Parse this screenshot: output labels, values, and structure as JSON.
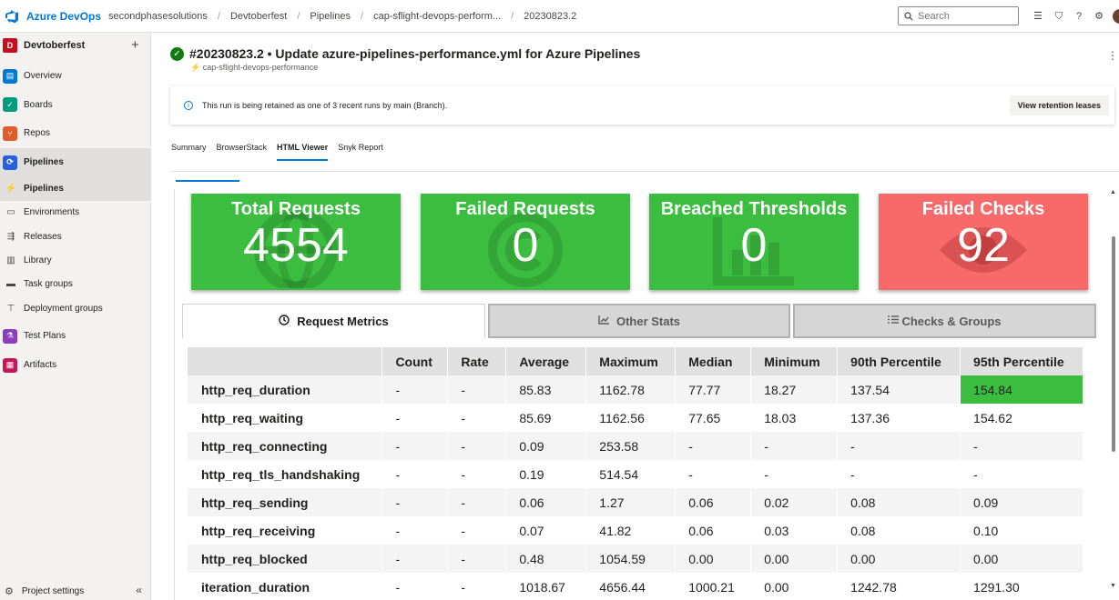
{
  "topbar": {
    "brand": "Azure DevOps",
    "breadcrumbs": [
      "secondphasesolutions",
      "Devtoberfest",
      "Pipelines",
      "cap-sflight-devops-perform...",
      "20230823.2"
    ],
    "search_placeholder": "Search",
    "icons": [
      "list-icon",
      "marketplace-icon",
      "help-icon",
      "user-settings-icon"
    ]
  },
  "sidebar": {
    "project_initial": "D",
    "project_name": "Devtoberfest",
    "items": [
      {
        "label": "Overview",
        "icon": "overview-icon",
        "color": "#0078d4"
      },
      {
        "label": "Boards",
        "icon": "boards-icon",
        "color": "#009c7b"
      },
      {
        "label": "Repos",
        "icon": "repos-icon",
        "color": "#e05c2c"
      },
      {
        "label": "Pipelines",
        "icon": "pipelines-icon",
        "color": "#2560e0"
      }
    ],
    "subitems": [
      {
        "label": "Pipelines",
        "icon": "pipelines-sub-icon"
      },
      {
        "label": "Environments",
        "icon": "environments-icon"
      },
      {
        "label": "Releases",
        "icon": "releases-icon"
      },
      {
        "label": "Library",
        "icon": "library-icon"
      },
      {
        "label": "Task groups",
        "icon": "task-groups-icon"
      },
      {
        "label": "Deployment groups",
        "icon": "deployment-groups-icon"
      }
    ],
    "items_after": [
      {
        "label": "Test Plans",
        "icon": "test-plans-icon",
        "color": "#8b3dbd"
      },
      {
        "label": "Artifacts",
        "icon": "artifacts-icon",
        "color": "#c2185b"
      }
    ],
    "settings_label": "Project settings",
    "collapse_glyph": "«"
  },
  "run": {
    "title": "#20230823.2 • Update azure-pipelines-performance.yml for Azure Pipelines",
    "pipeline_name": "cap-sflight-devops-performance",
    "status": "succeeded"
  },
  "banner": {
    "text": "This run is being retained as one of 3 recent runs by main (Branch).",
    "button_label": "View retention leases"
  },
  "tabs": [
    "Summary",
    "BrowserStack",
    "HTML Viewer",
    "Snyk Report"
  ],
  "active_tab": "HTML Viewer",
  "cards": [
    {
      "title": "Total Requests",
      "value": "4554",
      "color": "#3bbd3f",
      "bg_icon": "globe-icon"
    },
    {
      "title": "Failed Requests",
      "value": "0",
      "color": "#3bbd3f",
      "bg_icon": "copyright-icon"
    },
    {
      "title": "Breached Thresholds",
      "value": "0",
      "color": "#3bbd3f",
      "bg_icon": "bar-chart-icon"
    },
    {
      "title": "Failed Checks",
      "value": "92",
      "color": "#f86a6a",
      "bg_icon": "eye-icon"
    }
  ],
  "metric_tabs": [
    {
      "label": "Request Metrics",
      "icon": "clock-icon",
      "active": true
    },
    {
      "label": "Other Stats",
      "icon": "chart-line-icon",
      "active": false
    },
    {
      "label": "Checks & Groups",
      "icon": "tasks-icon",
      "active": false
    }
  ],
  "table": {
    "headers": [
      "",
      "Count",
      "Rate",
      "Average",
      "Maximum",
      "Median",
      "Minimum",
      "90th Percentile",
      "95th Percentile"
    ],
    "rows": [
      [
        "http_req_duration",
        "-",
        "-",
        "85.83",
        "1162.78",
        "77.77",
        "18.27",
        "137.54",
        "154.84"
      ],
      [
        "http_req_waiting",
        "-",
        "-",
        "85.69",
        "1162.56",
        "77.65",
        "18.03",
        "137.36",
        "154.62"
      ],
      [
        "http_req_connecting",
        "-",
        "-",
        "0.09",
        "253.58",
        "-",
        "-",
        "-",
        "-"
      ],
      [
        "http_req_tls_handshaking",
        "-",
        "-",
        "0.19",
        "514.54",
        "-",
        "-",
        "-",
        "-"
      ],
      [
        "http_req_sending",
        "-",
        "-",
        "0.06",
        "1.27",
        "0.06",
        "0.02",
        "0.08",
        "0.09"
      ],
      [
        "http_req_receiving",
        "-",
        "-",
        "0.07",
        "41.82",
        "0.06",
        "0.03",
        "0.08",
        "0.10"
      ],
      [
        "http_req_blocked",
        "-",
        "-",
        "0.48",
        "1054.59",
        "0.00",
        "0.00",
        "0.00",
        "0.00"
      ],
      [
        "iteration_duration",
        "-",
        "-",
        "1018.67",
        "4656.44",
        "1000.21",
        "0.00",
        "1242.78",
        "1291.30"
      ]
    ],
    "highlight_color": "#3bbd3f"
  }
}
